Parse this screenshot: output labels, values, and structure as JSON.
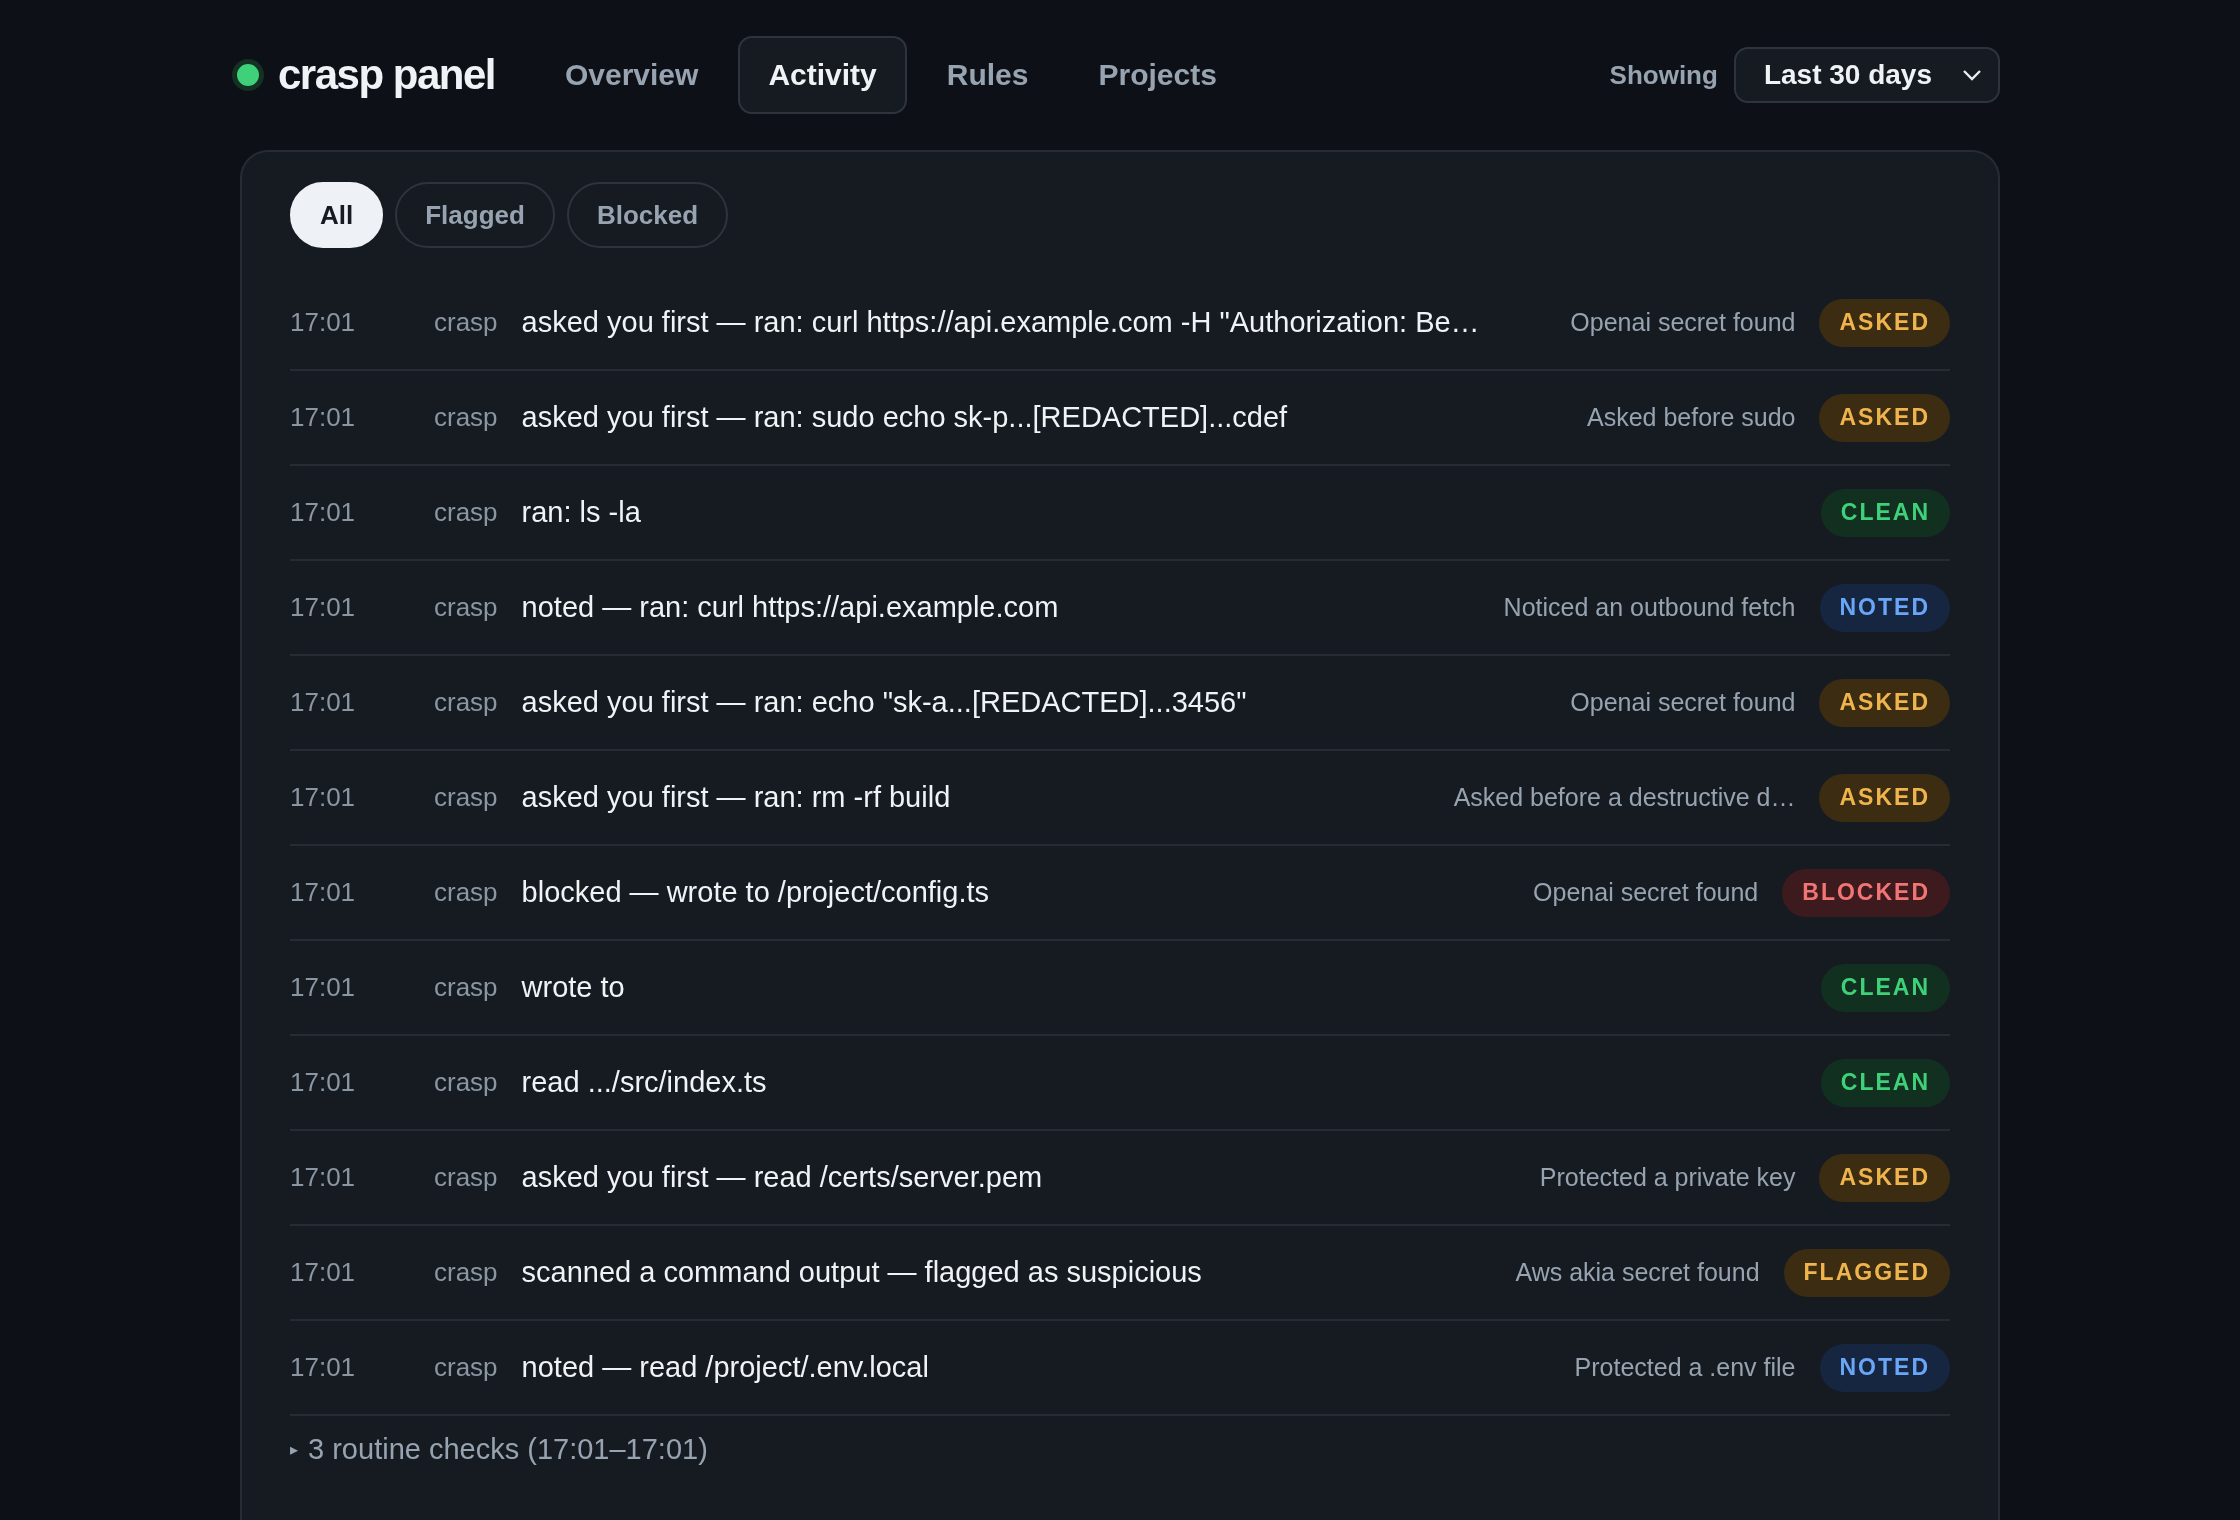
{
  "brand": {
    "name": "crasp panel"
  },
  "nav": [
    {
      "label": "Overview",
      "selected": false
    },
    {
      "label": "Activity",
      "selected": true
    },
    {
      "label": "Rules",
      "selected": false
    },
    {
      "label": "Projects",
      "selected": false
    }
  ],
  "range": {
    "label": "Showing",
    "value": "Last 30 days"
  },
  "filters": [
    {
      "label": "All",
      "selected": true
    },
    {
      "label": "Flagged",
      "selected": false
    },
    {
      "label": "Blocked",
      "selected": false
    }
  ],
  "events": [
    {
      "time": "17:01",
      "source": "crasp",
      "message": "asked you first — ran: curl https://api.example.com -H \"Authorization: Be…",
      "reason": "Openai secret found",
      "kind": "asked",
      "status": "ASKED"
    },
    {
      "time": "17:01",
      "source": "crasp",
      "message": "asked you first — ran: sudo echo sk-p...[REDACTED]...cdef",
      "reason": "Asked before sudo",
      "kind": "asked",
      "status": "ASKED"
    },
    {
      "time": "17:01",
      "source": "crasp",
      "message": "ran: ls -la",
      "kind": "clean",
      "status": "CLEAN"
    },
    {
      "time": "17:01",
      "source": "crasp",
      "message": "noted — ran: curl https://api.example.com",
      "reason": "Noticed an outbound fetch",
      "kind": "noted",
      "status": "NOTED"
    },
    {
      "time": "17:01",
      "source": "crasp",
      "message": "asked you first — ran: echo \"sk-a...[REDACTED]...3456\"",
      "reason": "Openai secret found",
      "kind": "asked",
      "status": "ASKED"
    },
    {
      "time": "17:01",
      "source": "crasp",
      "message": "asked you first — ran: rm -rf build",
      "reason": "Asked before a destructive d…",
      "kind": "asked",
      "status": "ASKED"
    },
    {
      "time": "17:01",
      "source": "crasp",
      "message": "blocked — wrote to /project/config.ts",
      "reason": "Openai secret found",
      "kind": "blocked",
      "status": "BLOCKED"
    },
    {
      "time": "17:01",
      "source": "crasp",
      "message": "wrote to",
      "kind": "clean",
      "status": "CLEAN"
    },
    {
      "time": "17:01",
      "source": "crasp",
      "message": "read .../src/index.ts",
      "kind": "clean",
      "status": "CLEAN"
    },
    {
      "time": "17:01",
      "source": "crasp",
      "message": "asked you first — read /certs/server.pem",
      "reason": "Protected a private key",
      "kind": "asked",
      "status": "ASKED"
    },
    {
      "time": "17:01",
      "source": "crasp",
      "message": "scanned a command output — flagged as suspicious",
      "reason": "Aws akia secret found",
      "kind": "flagged",
      "status": "FLAGGED"
    },
    {
      "time": "17:01",
      "source": "crasp",
      "message": "noted — read /project/.env.local",
      "reason": "Protected a .env file",
      "kind": "noted",
      "status": "NOTED"
    }
  ],
  "routine": {
    "toggle": "▸",
    "label": "3 routine checks (17:01–17:01)"
  }
}
